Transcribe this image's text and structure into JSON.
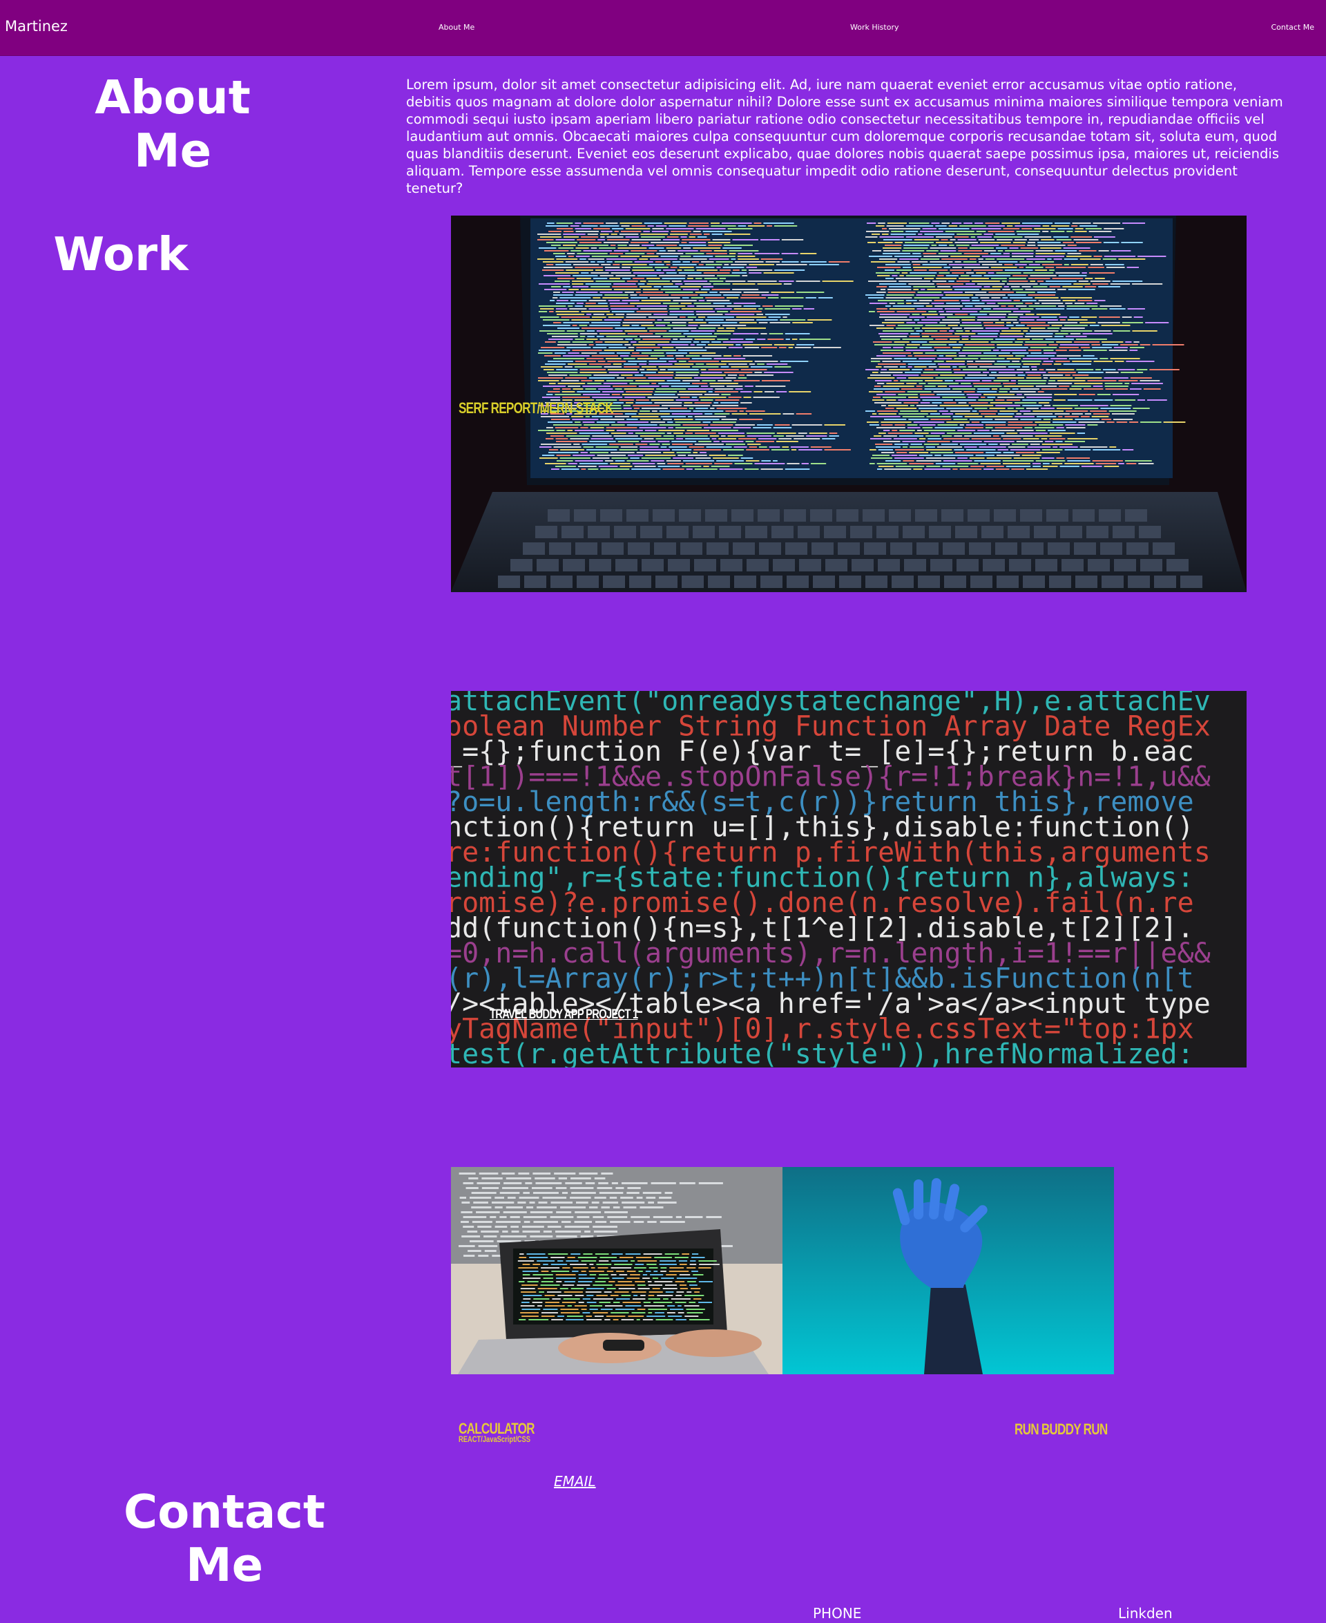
{
  "nav": {
    "brand": "Martinez",
    "links": [
      "About Me",
      "Work History",
      "Contact Me"
    ]
  },
  "about": {
    "heading": "About Me",
    "text": "Lorem ipsum, dolor sit amet consectetur adipisicing elit. Ad, iure nam quaerat eveniet error accusamus vitae optio ratione, debitis quos magnam at dolore dolor aspernatur nihil? Dolore esse sunt ex accusamus minima maiores similique tempora veniam commodi sequi iusto ipsam aperiam libero pariatur ratione odio consectetur necessitatibus tempore in, repudiandae officiis vel laudantium aut omnis. Obcaecati maiores culpa consequuntur cum doloremque corporis recusandae totam sit, soluta eum, quod quas blanditiis deserunt. Eveniet eos deserunt explicabo, quae dolores nobis quaerat saepe possimus ipsa, maiores ut, reiciendis aliquam. Tempore esse assumenda vel omnis consequatur impedit odio ratione deserunt, consequuntur delectus provident tenetur?"
  },
  "work": {
    "heading": "Work",
    "projects": [
      {
        "label": "SERF REPORT/MERN-STACK"
      },
      {
        "label": "TRAVEL BUDDY APP PROJECT 1"
      },
      {
        "label": "CALCULATOR",
        "sublabel": "REACT/JavaScript/CSS"
      },
      {
        "label": "RUN BUDDY RUN"
      }
    ],
    "code_lines": [
      "attachEvent(\"onreadystatechange\",H),e.attachEv",
      "oolean Number String Function Array Date RegEx",
      "_={};function F(e){var t=_[e]={};return b.eac",
      "t[1])===!1&&e.stopOnFalse){r=!1;break}n=!1,u&&",
      "?o=u.length:r&&(s=t,c(r))}return this},remove",
      "nction(){return u=[],this},disable:function()",
      "re:function(){return p.fireWith(this,arguments",
      "ending\",r={state:function(){return n},always:",
      "romise)?e.promise().done(n.resolve).fail(n.re",
      "dd(function(){n=s},t[1^e][2].disable,t[2][2].",
      "=0,n=h.call(arguments),r=n.length,i=1!==r||e&&",
      "(r),l=Array(r);r>t;t++)n[t]&&b.isFunction(n[t",
      "/><table></table><a href='/a'>a</a><input type",
      "yTagName(\"input\")[0],r.style.cssText=\"top:1px",
      "test(r.getAttribute(\"style\")),hrefNormalized:"
    ]
  },
  "contact": {
    "heading": "Contact Me",
    "email": "EMAIL",
    "phone": "PHONE",
    "linkedin": "Linkden"
  },
  "colors": {
    "page_bg": "#8a2be2",
    "navbar_bg": "#800080",
    "label_yellow": "#e5c93a"
  }
}
